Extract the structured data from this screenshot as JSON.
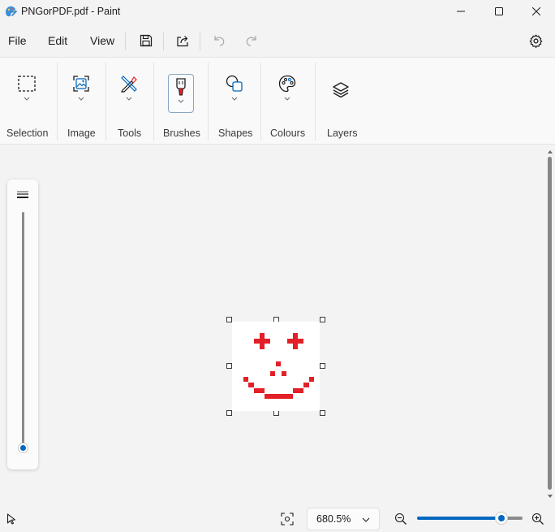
{
  "window": {
    "title": "PNGorPDF.pdf - Paint"
  },
  "menu": {
    "file": "File",
    "edit": "Edit",
    "view": "View"
  },
  "ribbon": {
    "groups": [
      {
        "label": "Selection",
        "icon": "selection-rectangle-icon"
      },
      {
        "label": "Image",
        "icon": "image-icon"
      },
      {
        "label": "Tools",
        "icon": "tools-icon"
      },
      {
        "label": "Brushes",
        "icon": "brush-icon"
      },
      {
        "label": "Shapes",
        "icon": "shapes-icon"
      },
      {
        "label": "Colours",
        "icon": "palette-icon"
      },
      {
        "label": "Layers",
        "icon": "layers-icon"
      }
    ]
  },
  "canvas": {
    "image_color": "#e32027"
  },
  "brush_size": {
    "level": 0.0
  },
  "status": {
    "zoom_label": "680.5%",
    "zoom_fraction": 0.82
  },
  "colors": {
    "accent": "#0067c0"
  }
}
